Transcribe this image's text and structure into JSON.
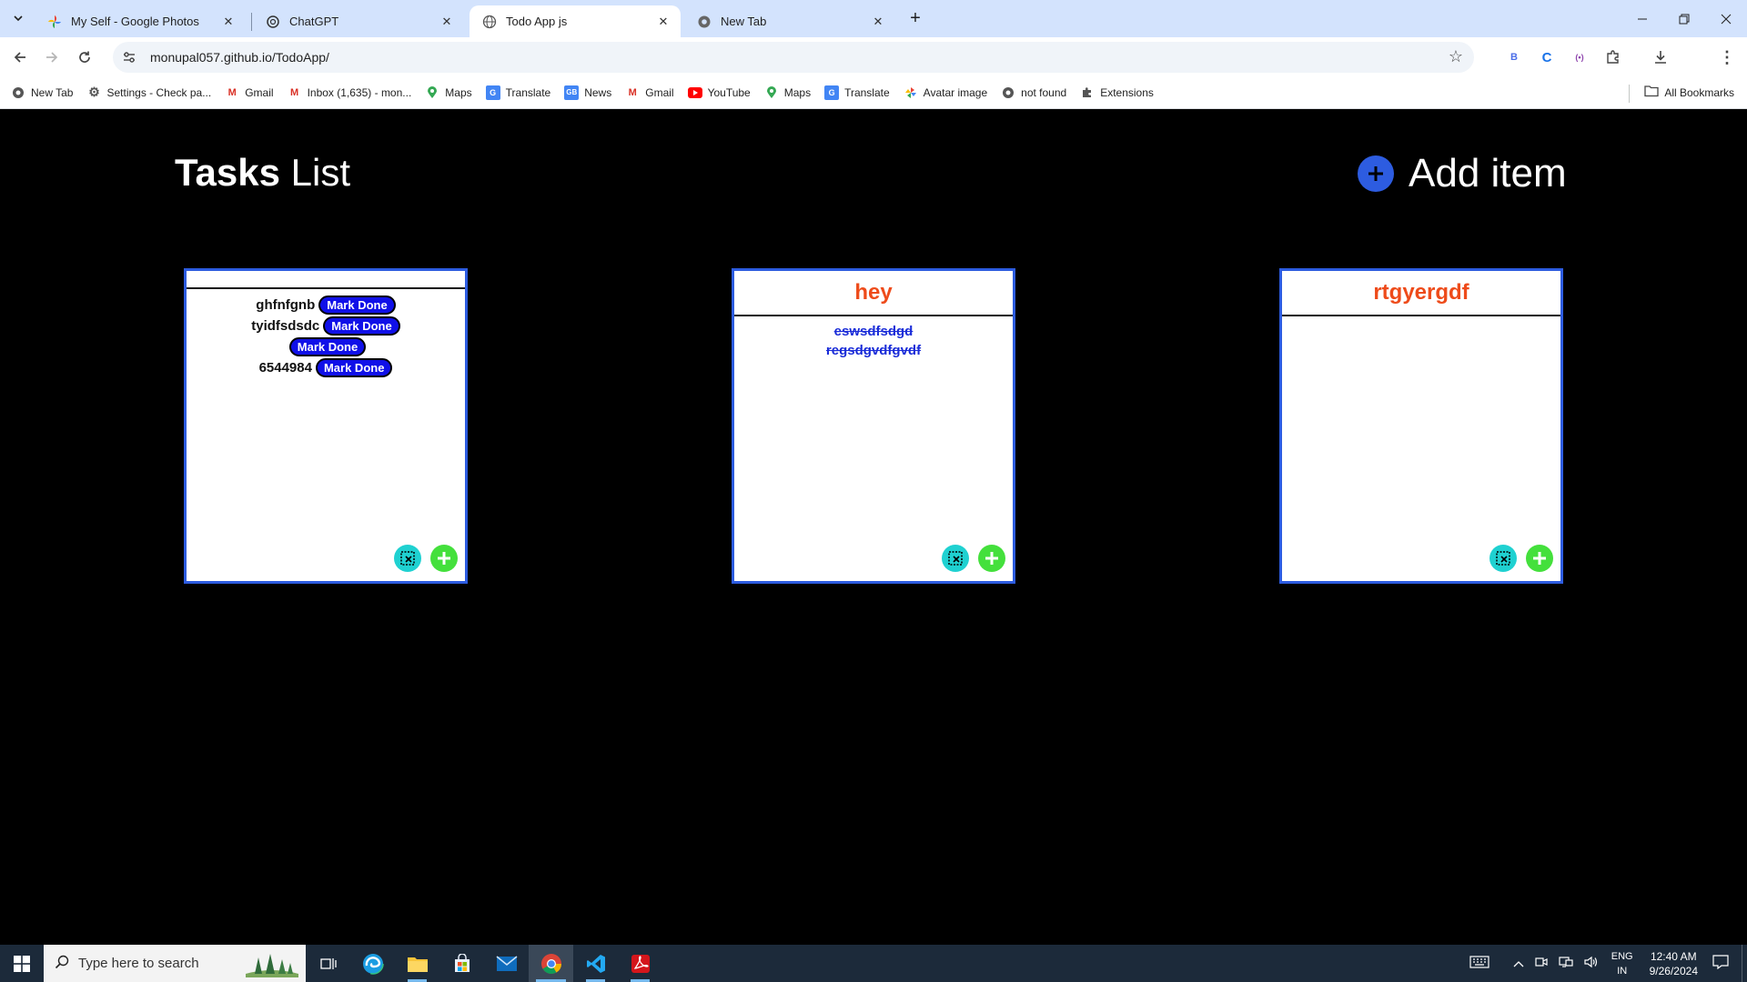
{
  "browser": {
    "tabs": [
      {
        "title": "My Self - Google Photos",
        "active": false
      },
      {
        "title": "ChatGPT",
        "active": false
      },
      {
        "title": "Todo App js",
        "active": true
      },
      {
        "title": "New Tab",
        "active": false
      }
    ],
    "url": "monupal057.github.io/TodoApp/",
    "extensions": [
      "B",
      "C",
      "(•)"
    ]
  },
  "bookmarks": [
    {
      "label": "New Tab",
      "icon": "globe-icon"
    },
    {
      "label": "Settings - Check pa...",
      "icon": "gear-icon"
    },
    {
      "label": "Gmail",
      "icon": "gmail-icon"
    },
    {
      "label": "Inbox (1,635) - mon...",
      "icon": "gmail-icon"
    },
    {
      "label": "Maps",
      "icon": "maps-icon"
    },
    {
      "label": "Translate",
      "icon": "translate-icon"
    },
    {
      "label": "News",
      "icon": "news-icon"
    },
    {
      "label": "Gmail",
      "icon": "gmail-icon"
    },
    {
      "label": "YouTube",
      "icon": "youtube-icon"
    },
    {
      "label": "Maps",
      "icon": "maps-icon"
    },
    {
      "label": "Translate",
      "icon": "translate-icon"
    },
    {
      "label": "Avatar image",
      "icon": "pinwheel-icon"
    },
    {
      "label": "not found",
      "icon": "globe-icon"
    },
    {
      "label": "Extensions",
      "icon": "puzzle-icon"
    }
  ],
  "all_bookmarks_label": "All Bookmarks",
  "app": {
    "title_bold": "Tasks",
    "title_light": "List",
    "add_item_label": "Add item",
    "mark_done_label": "Mark Done",
    "cards": [
      {
        "title": "",
        "tasks": [
          {
            "text": "ghfnfgnb",
            "done": false
          },
          {
            "text": "tyidfsdsdc",
            "done": false
          },
          {
            "text": "",
            "done": false
          },
          {
            "text": "6544984",
            "done": false
          }
        ]
      },
      {
        "title": "hey",
        "tasks": [
          {
            "text": "eswsdfsdgd",
            "done": true
          },
          {
            "text": "regsdgvdfgvdf",
            "done": true
          }
        ]
      },
      {
        "title": "rtgyergdf",
        "tasks": []
      }
    ]
  },
  "taskbar": {
    "search_placeholder": "Type here to search",
    "language_line1": "ENG",
    "language_line2": "IN",
    "time": "12:40 AM",
    "date": "9/26/2024"
  }
}
